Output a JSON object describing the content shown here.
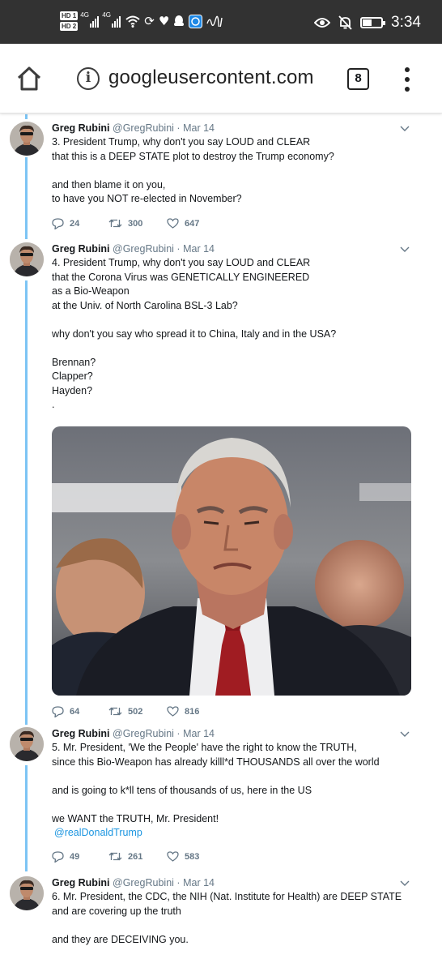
{
  "status_bar": {
    "hd_top": "HD",
    "hd_top_sub": "1",
    "hd_bottom": "HD",
    "hd_bottom_sub": "2",
    "net_1": "4G",
    "net_2": "4G",
    "time": "3:34",
    "battery_level": 0.5,
    "icons": [
      "hd-icon",
      "signal-icon",
      "wifi-icon",
      "sync-icon",
      "health-icon",
      "notification-icon",
      "browser-app-icon",
      "signature-icon",
      "eye-comfort-icon",
      "mute-icon",
      "battery-icon"
    ]
  },
  "browser": {
    "url": "googleusercontent.com",
    "tab_count": "8"
  },
  "tweets": [
    {
      "author": "Greg Rubini",
      "handle": "@GregRubini",
      "separator": "·",
      "date": "Mar 14",
      "lines": [
        "3. President Trump, why don't you say LOUD and CLEAR",
        "that this is a DEEP STATE plot to destroy the Trump economy?",
        "",
        "and then blame it on you,",
        "to have you NOT re-elected in November?"
      ],
      "replies": "24",
      "retweets": "300",
      "likes": "647"
    },
    {
      "author": "Greg Rubini",
      "handle": "@GregRubini",
      "separator": "·",
      "date": "Mar 14",
      "lines": [
        "4. President Trump, why don't you say LOUD and CLEAR",
        "that the Corona Virus was GENETICALLY ENGINEERED",
        "as a Bio-Weapon",
        "at the Univ. of North Carolina BSL-3 Lab?",
        "",
        "why don't you say who spread it to China, Italy and in the USA?",
        "",
        "Brennan?",
        "Clapper?",
        "Hayden?",
        "."
      ],
      "replies": "64",
      "retweets": "502",
      "likes": "816"
    },
    {
      "author": "Greg Rubini",
      "handle": "@GregRubini",
      "separator": "·",
      "date": "Mar 14",
      "lines": [
        "5. Mr. President, 'We the People' have the right to know the TRUTH,",
        "since this Bio-Weapon has already killl*d THOUSANDS all over the world",
        "",
        "and is going to k*ll tens of thousands of us, here in the US",
        "",
        "we WANT the TRUTH, Mr. President!"
      ],
      "mention": "@realDonaldTrump",
      "replies": "49",
      "retweets": "261",
      "likes": "583"
    },
    {
      "author": "Greg Rubini",
      "handle": "@GregRubini",
      "separator": "·",
      "date": "Mar 14",
      "lines": [
        "6. Mr. President, the CDC, the NIH (Nat. Institute for Health) are DEEP STATE",
        "and are covering up the truth",
        "",
        "and they are DECEIVING you."
      ]
    }
  ]
}
